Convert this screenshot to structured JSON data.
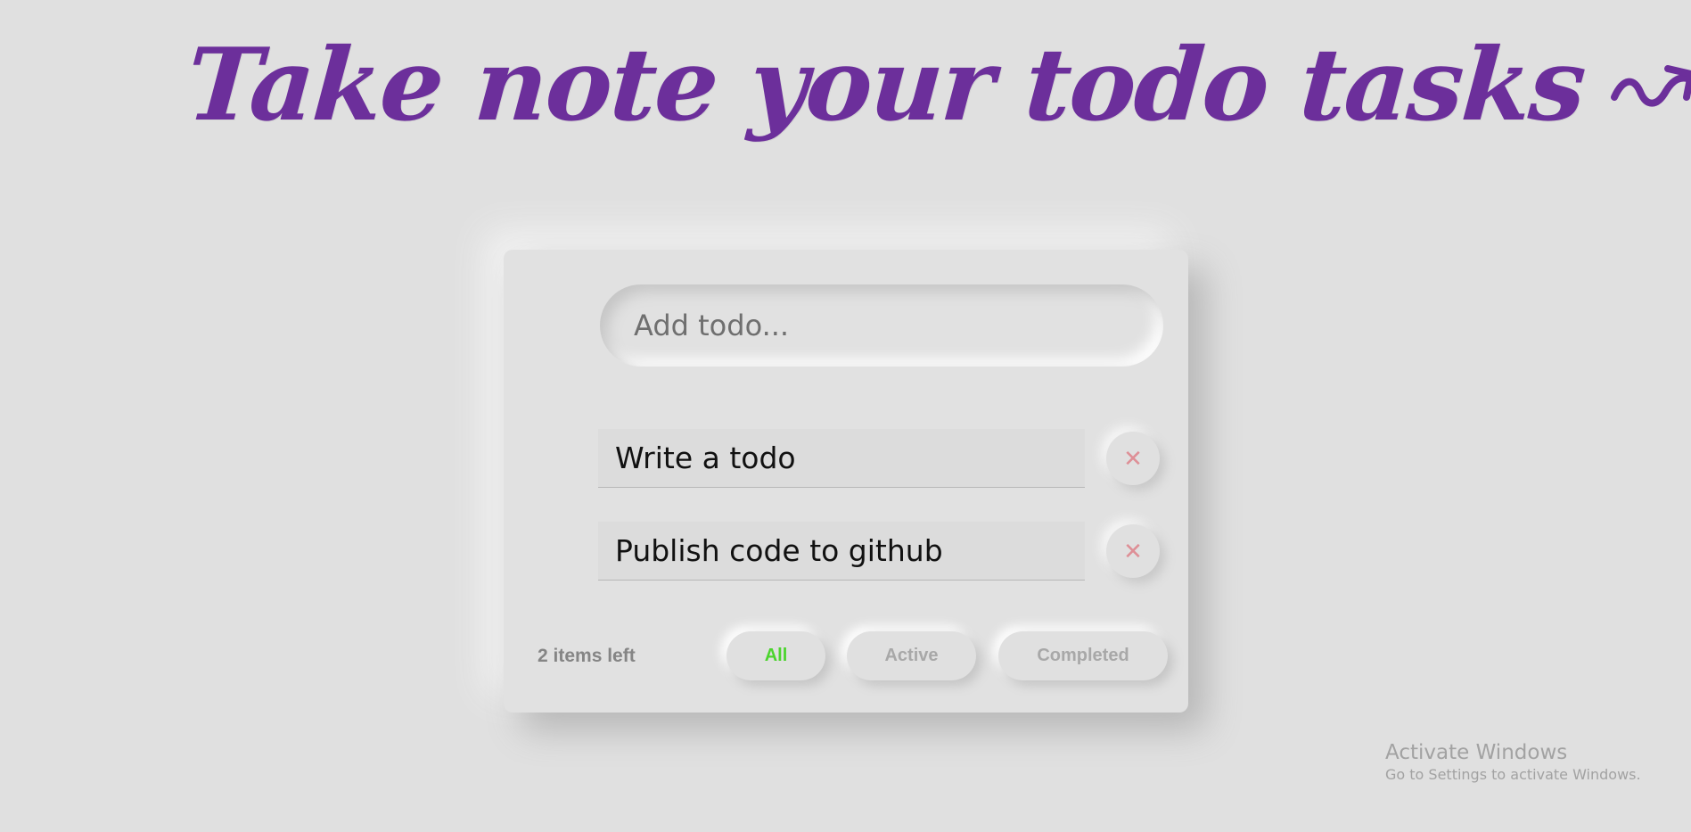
{
  "heading": {
    "title": "Take note your todo tasks",
    "icon": "squiggle-arrow-icon",
    "color": "#6c2f9b"
  },
  "input": {
    "placeholder": "Add todo..."
  },
  "todos": [
    {
      "text": "Write a todo",
      "delete_icon": "close-icon"
    },
    {
      "text": "Publish code to github",
      "delete_icon": "close-icon"
    }
  ],
  "footer": {
    "items_left": "2 items left",
    "filters": [
      {
        "label": "All",
        "selected": true,
        "color": "#4bd42d"
      },
      {
        "label": "Active",
        "selected": false
      },
      {
        "label": "Completed",
        "selected": false
      }
    ]
  },
  "watermark": {
    "title": "Activate Windows",
    "subtitle": "Go to Settings to activate Windows."
  },
  "colors": {
    "background": "#e0e0e0",
    "delete_icon": "#de8f96",
    "muted_text": "#a8a8a8"
  }
}
